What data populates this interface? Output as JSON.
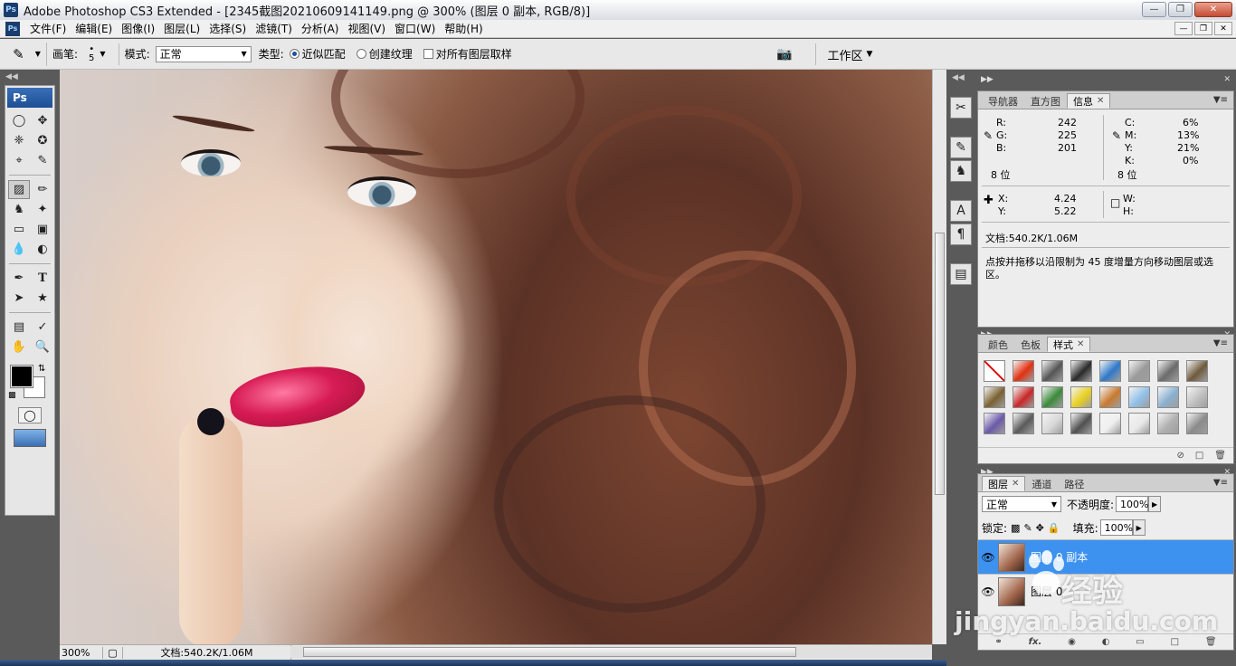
{
  "window": {
    "title": "Adobe Photoshop CS3 Extended - [2345截图20210609141149.png @ 300% (图层 0 副本, RGB/8)]",
    "logo_text": "Ps"
  },
  "menu": [
    "文件(F)",
    "编辑(E)",
    "图像(I)",
    "图层(L)",
    "选择(S)",
    "滤镜(T)",
    "分析(A)",
    "视图(V)",
    "窗口(W)",
    "帮助(H)"
  ],
  "options_bar": {
    "brush_label": "画笔:",
    "brush_size": "5",
    "mode_label": "模式:",
    "mode_value": "正常",
    "type_label": "类型:",
    "radio_proximity": "近似匹配",
    "radio_texture": "创建纹理",
    "sample_all": "对所有图层取样",
    "workspace": "工作区"
  },
  "toolbox": {
    "badge": "Ps"
  },
  "status": {
    "zoom": "300%",
    "doc": "文档:540.2K/1.06M"
  },
  "info_panel": {
    "tabs": [
      "导航器",
      "直方图",
      "信息"
    ],
    "r_label": "R:",
    "r": "242",
    "g_label": "G:",
    "g": "225",
    "b_label": "B:",
    "b": "201",
    "bits_left": "8 位",
    "c_label": "C:",
    "c": "6%",
    "m_label": "M:",
    "m": "13%",
    "y_label": "Y:",
    "y": "21%",
    "k_label": "K:",
    "k": "0%",
    "bits_right": "8 位",
    "x_label": "X:",
    "x": "4.24",
    "ypos_label": "Y:",
    "ypos": "5.22",
    "w_label": "W:",
    "h_label": "H:",
    "doc": "文档:540.2K/1.06M",
    "hint": "点按并拖移以沿限制为 45 度增量方向移动图层或选区。"
  },
  "styles_panel": {
    "tabs": [
      "颜色",
      "色板",
      "样式"
    ],
    "swatches": [
      "#ffffff",
      "#e03010",
      "#555555",
      "#2a2a2a",
      "#2f78c8",
      "#9a9a9a",
      "#6a6a6a",
      "#6e5a3e",
      "#7a6030",
      "#c82828",
      "#3a8a3a",
      "#e8d020",
      "#c87a30",
      "#90c0e8",
      "#8ab0d0",
      "#c0c0c0",
      "#6a58a8",
      "#5a5a5a",
      "#d8d8d8",
      "#505050",
      "#f0f0f0",
      "#e8e8e8",
      "#b0b0b0",
      "#8a8a8a"
    ]
  },
  "layers_panel": {
    "tabs": [
      "图层",
      "通道",
      "路径"
    ],
    "blend_mode": "正常",
    "opacity_label": "不透明度:",
    "opacity": "100%",
    "lock_label": "锁定:",
    "fill_label": "填充:",
    "fill": "100%",
    "layers": [
      {
        "name": "图层 0 副本",
        "selected": true
      },
      {
        "name": "图层 0",
        "selected": false
      }
    ],
    "footer_fx": "fx."
  },
  "watermark": {
    "brand": "经验",
    "url": "jingyan.baidu.com"
  },
  "colors": {
    "selection": "#3d92f0",
    "panel_bg": "#ededed",
    "workspace_bg": "#5a5a5a"
  }
}
